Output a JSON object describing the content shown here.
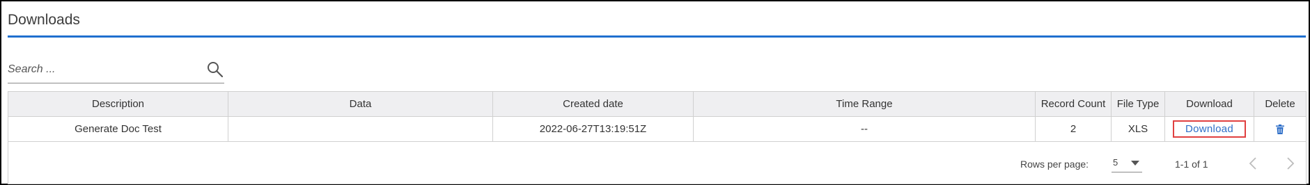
{
  "page": {
    "title": "Downloads"
  },
  "search": {
    "placeholder": "Search ..."
  },
  "table": {
    "headers": {
      "description": "Description",
      "data": "Data",
      "created_date": "Created date",
      "time_range": "Time Range",
      "record_count": "Record Count",
      "file_type": "File Type",
      "download": "Download",
      "delete": "Delete"
    },
    "rows": [
      {
        "description": "Generate Doc Test",
        "data": "",
        "created_date": "2022-06-27T13:19:51Z",
        "time_range": "--",
        "record_count": "2",
        "file_type": "XLS",
        "download_label": "Download"
      }
    ]
  },
  "pagination": {
    "rows_per_page_label": "Rows per page:",
    "rows_per_page_value": "5",
    "range_text": "1-1 of 1"
  },
  "icons": {
    "search": "search-icon",
    "delete": "trash-icon",
    "dropdown": "chevron-down-icon",
    "prev": "chevron-left-icon",
    "next": "chevron-right-icon"
  },
  "colors": {
    "accent": "#1f6fcf",
    "link": "#2f6fc8",
    "highlight_border": "#e04040",
    "header_bg": "#efeff1"
  }
}
